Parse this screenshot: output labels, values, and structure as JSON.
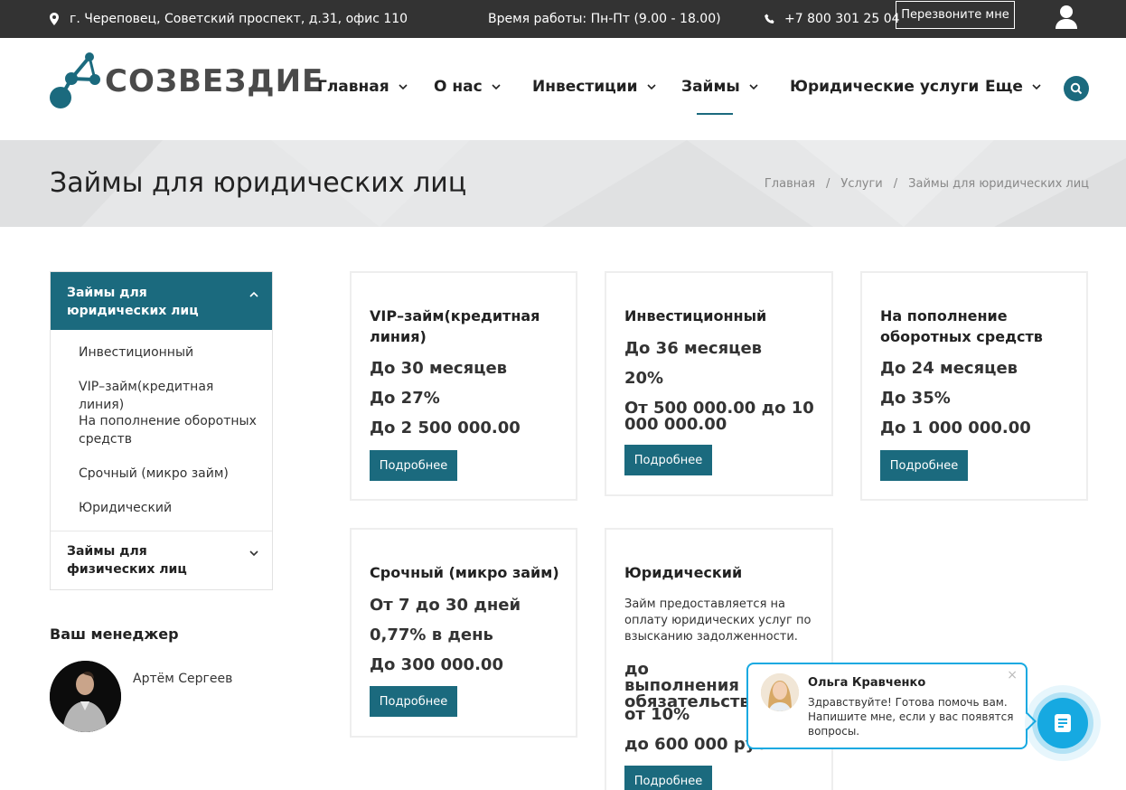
{
  "topbar": {
    "address": "г. Череповец, Советский проспект, д.31, офис 110",
    "hours": "Время работы: Пн-Пт (9.00 - 18.00)",
    "phone": "+7 800 301 25 04",
    "callback_label": "Перезвоните мне"
  },
  "header": {
    "logo_text": "СОЗВЕЗДИЕ",
    "nav": [
      {
        "label": "Главная",
        "dropdown": true
      },
      {
        "label": "О нас",
        "dropdown": true
      },
      {
        "label": "Инвестиции",
        "dropdown": true
      },
      {
        "label": "Займы",
        "dropdown": true,
        "active": true
      },
      {
        "label": "Юридические услуги",
        "dropdown": false
      },
      {
        "label": "Еще",
        "dropdown": true
      }
    ]
  },
  "banner": {
    "title": "Займы для юридических лиц",
    "breadcrumb": [
      "Главная",
      "/",
      "Услуги",
      "/",
      "Займы для юридических лиц"
    ]
  },
  "sidebar": {
    "active_title": "Займы для юридических лиц",
    "sub_items": [
      "Инвестиционный",
      "VIP–займ(кредитная линия)",
      "На пополнение оборотных средств",
      "Срочный (микро займ)",
      "Юридический"
    ],
    "other_title": "Займы для физических лиц"
  },
  "manager": {
    "heading": "Ваш менеджер",
    "name": "Артём Сергеев"
  },
  "cards": [
    {
      "title": "VIP–займ(кредитная линия)",
      "lines": [
        "До 30 месяцев",
        "До 27%",
        "До 2 500 000.00"
      ],
      "button": "Подробнее"
    },
    {
      "title": "Инвестиционный",
      "lines": [
        "До 36 месяцев",
        "20%",
        "От 500 000.00 до 10 000 000.00"
      ],
      "button": "Подробнее"
    },
    {
      "title": "На пополнение оборотных средств",
      "lines": [
        "До 24 месяцев",
        "До 35%",
        "До 1 000 000.00"
      ],
      "button": "Подробнее"
    },
    {
      "title": "Срочный (микро займ)",
      "lines": [
        "От 7 до 30 дней",
        "0,77% в день",
        "До 300 000.00"
      ],
      "button": "Подробнее"
    },
    {
      "title": "Юридический",
      "description": "Займ предоставляется на оплату юридических услуг по взысканию задолженности.",
      "lines": [
        "до выполнения обязательств",
        "от 10%",
        "до 600 000 рубл"
      ],
      "button": "Подробнее"
    }
  ],
  "chat": {
    "name": "Ольга Кравченко",
    "message": "Здравствуйте! Готова помочь вам. Напишите мне, если у вас появятся вопросы.",
    "close": "×"
  },
  "colors": {
    "accent": "#1b6a7e",
    "topbar_bg": "#333333",
    "banner_bg": "#e6e7e8",
    "chat_blue": "#16a9e1"
  }
}
